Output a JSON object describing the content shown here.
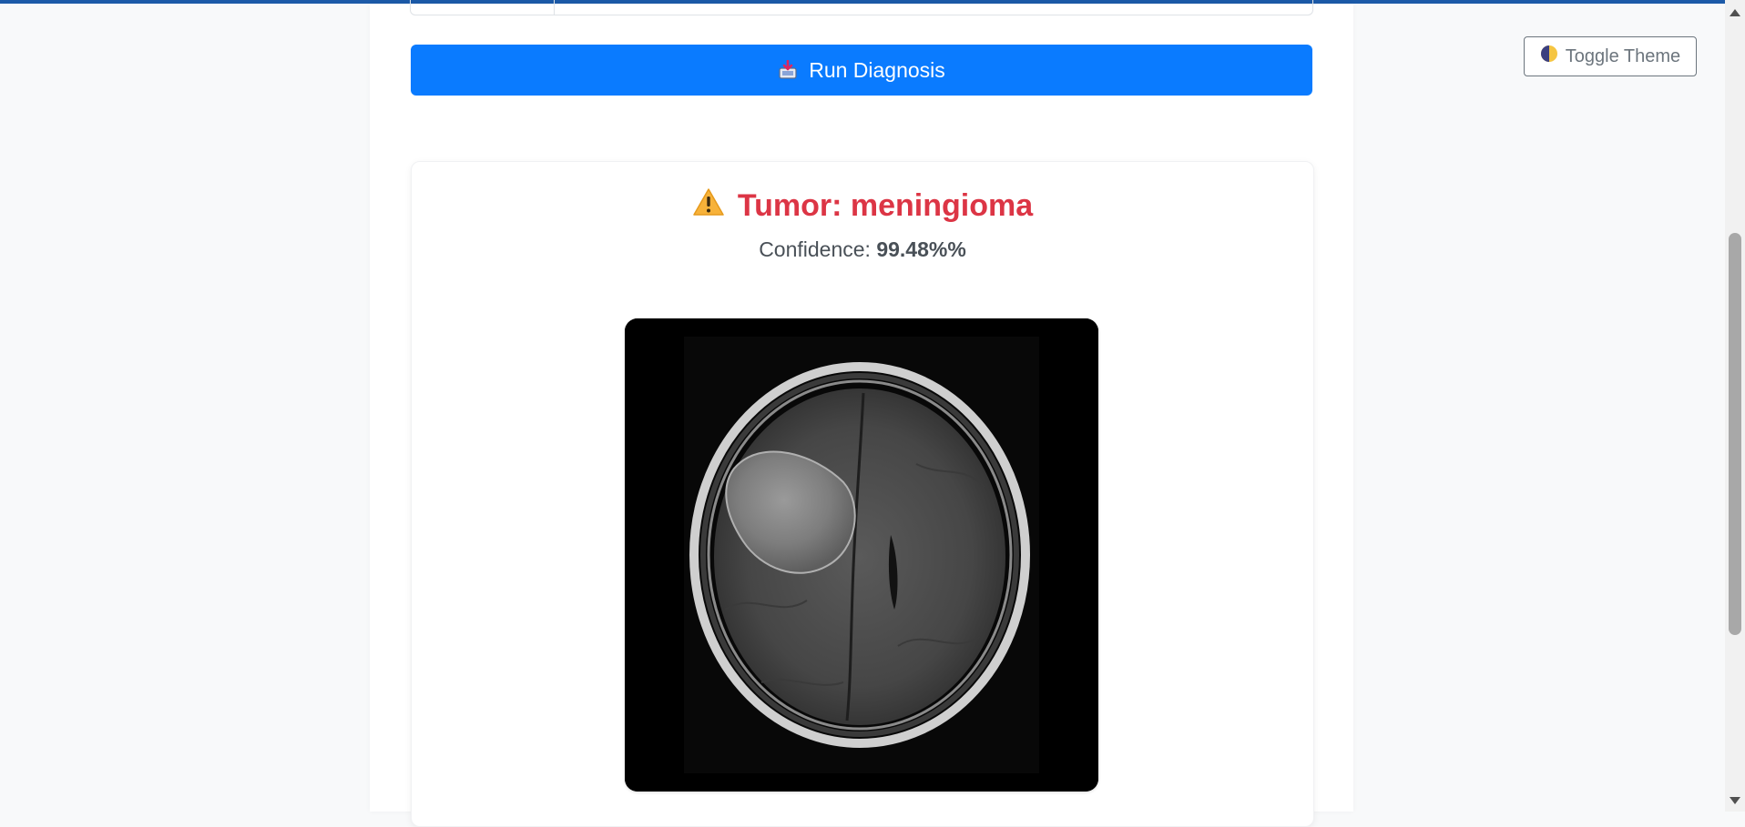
{
  "actions": {
    "run_label": "Run Diagnosis",
    "run_icon": "inbox-tray-icon",
    "toggle_label": "Toggle Theme",
    "toggle_icon": "half-moon-icon"
  },
  "result": {
    "warning_icon": "warning-icon",
    "title": "Tumor: meningioma",
    "confidence_label": "Confidence:",
    "confidence_value": "99.48%%"
  },
  "scan": {
    "type": "mri-brain-scan-image"
  },
  "colors": {
    "primary": "#0a7bff",
    "danger": "#dc3545",
    "topbar": "#1c5aa8",
    "secondary": "#6c757d"
  }
}
